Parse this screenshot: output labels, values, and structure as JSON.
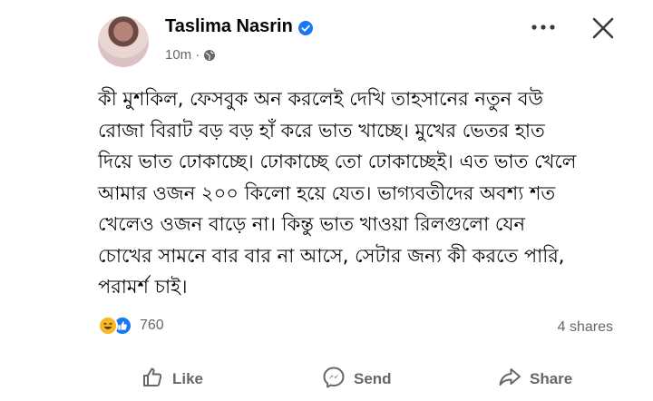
{
  "post": {
    "author": "Taslima Nasrin",
    "time": "10m",
    "text_lines": [
      "কী মুশকিল, ফেসবুক অন করলেই দেখি তাহসানের নতুন বউ",
      "রোজা বিরাট বড় বড় হাঁ করে ভাত খাচ্ছে। মুখের ভেতর হাত",
      "দিয়ে ভাত ঢোকাচ্ছে। ঢোকাচ্ছে তো ঢোকাচ্ছেই। এত ভাত খেলে",
      "আমার ওজন ২০০ কিলো হয়ে যেত। ভাগ্যবতীদের অবশ্য শত",
      "খেলেও ওজন বাড়ে না। কিন্তু ভাত খাওয়া রিলগুলো যেন",
      "চোখের সামনে বার বার না আসে, সেটার জন্য কী করতে পারি,",
      "পরামর্শ চাই।"
    ],
    "reaction_count": "760",
    "shares": "4 shares"
  },
  "actions": {
    "like": "Like",
    "send": "Send",
    "share": "Share"
  },
  "icons": {
    "verified": "verified-badge-icon",
    "audience": "globe-icon",
    "more": "more-options-icon",
    "close": "close-icon",
    "reactions": [
      "haha-reaction-icon",
      "like-reaction-icon"
    ]
  },
  "colors": {
    "brand_blue": "#1877f2",
    "secondary_text": "#65676b",
    "primary_text": "#050505",
    "haha_yellow": "#f7b928"
  }
}
